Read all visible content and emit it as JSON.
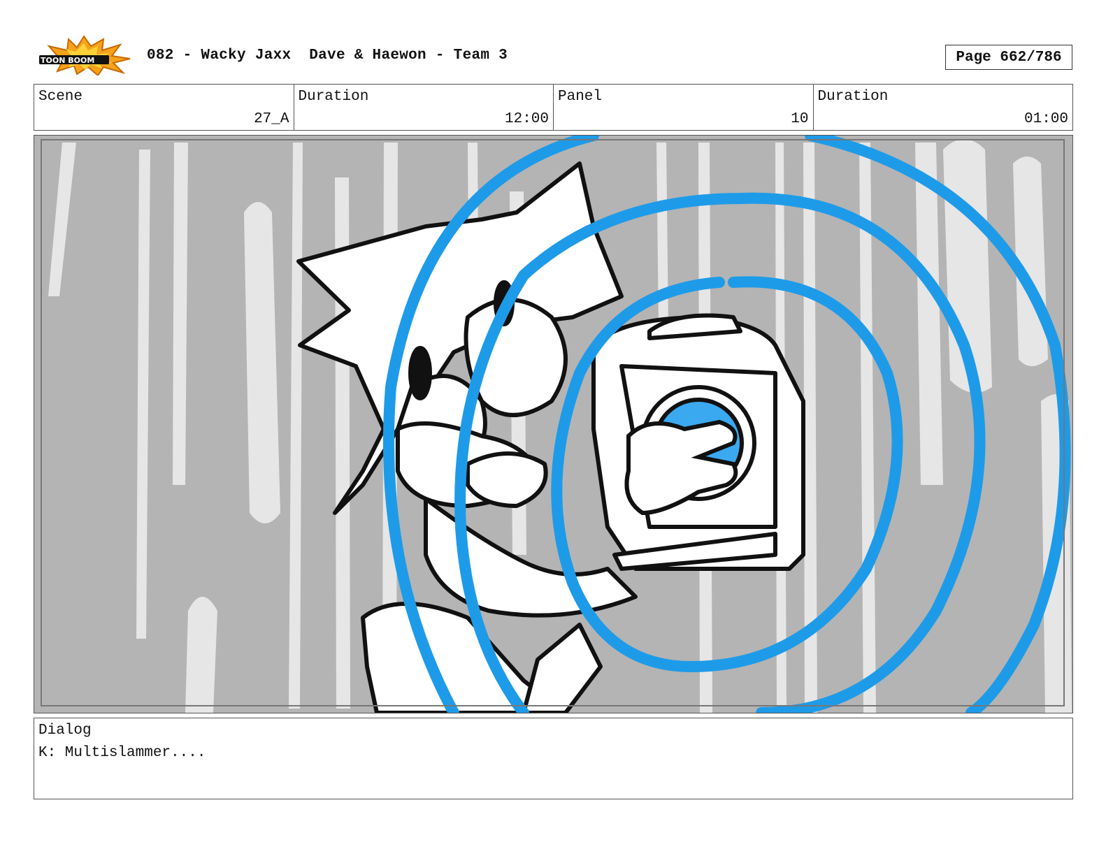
{
  "header": {
    "logo_text": "TOON BOOM",
    "title": "082 - Wacky Jaxx  Dave & Haewon - Team 3",
    "page": "Page 662/786"
  },
  "info": {
    "scene_label": "Scene",
    "scene_value": "27_A",
    "scene_duration_label": "Duration",
    "scene_duration_value": "12:00",
    "panel_label": "Panel",
    "panel_value": "10",
    "panel_duration_label": "Duration",
    "panel_duration_value": "01:00"
  },
  "panel": {
    "background_color": "#b4b4b4",
    "streak_color": "#e6e6e6",
    "accent_color": "#1e9be8",
    "icon": "storyboard-panel-drawing"
  },
  "dialog": {
    "label": "Dialog",
    "text": "K: Multislammer...."
  }
}
